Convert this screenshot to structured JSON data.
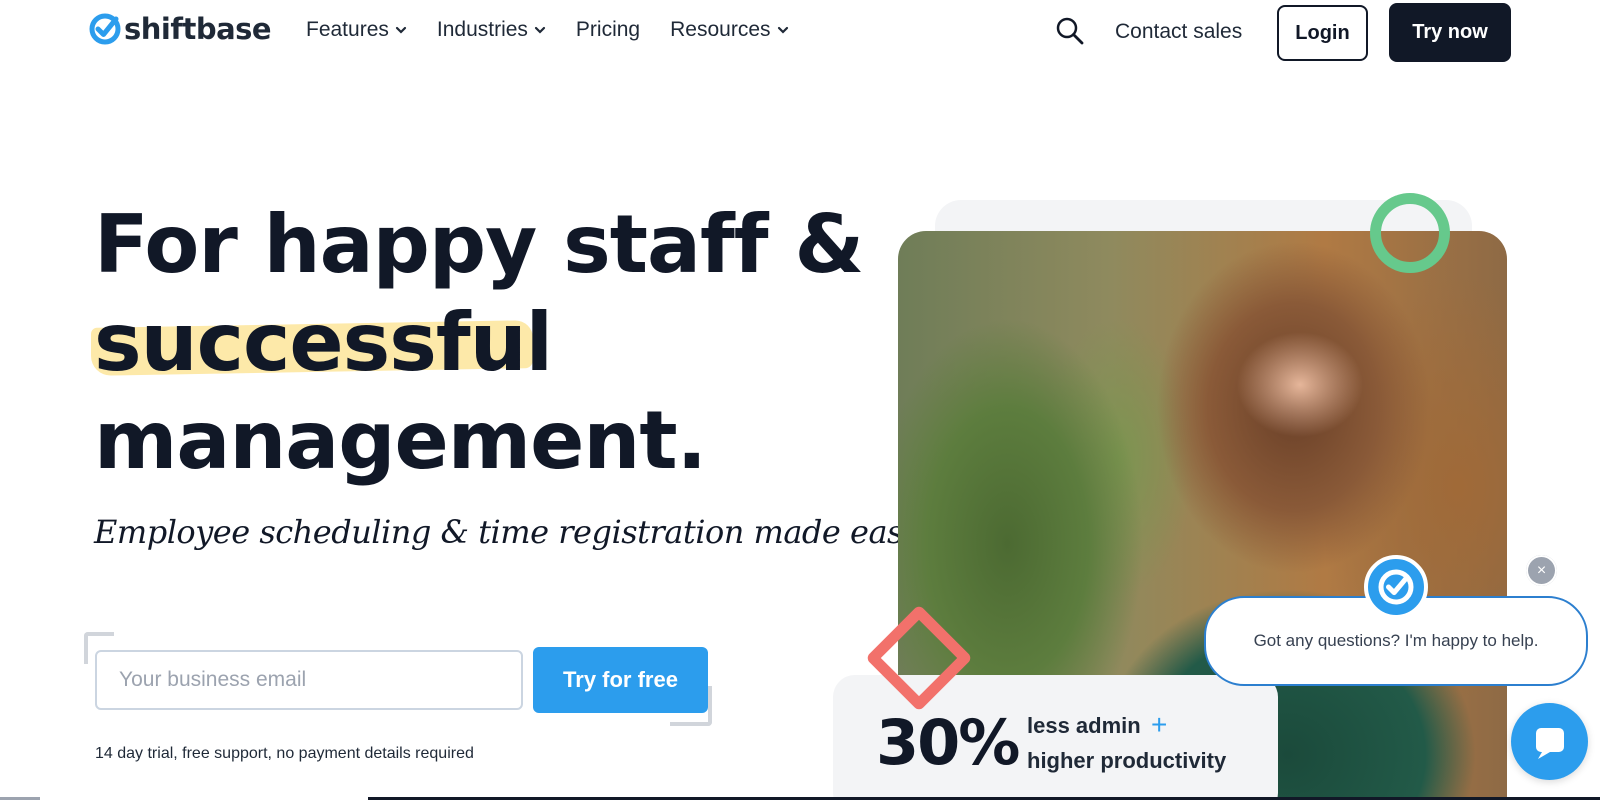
{
  "brand": {
    "name": "shiftbase",
    "accent": "#2c9ded",
    "dark": "#111827"
  },
  "nav": {
    "items": [
      {
        "label": "Features",
        "has_dropdown": true
      },
      {
        "label": "Industries",
        "has_dropdown": true
      },
      {
        "label": "Pricing",
        "has_dropdown": false
      },
      {
        "label": "Resources",
        "has_dropdown": true
      }
    ],
    "search_icon": "search-icon",
    "contact_label": "Contact sales",
    "login_label": "Login",
    "try_label": "Try now"
  },
  "hero": {
    "line1": "For happy staff &",
    "line2": "successful",
    "line3": "management.",
    "subheading": "Employee scheduling & time registration made easy",
    "email_placeholder": "Your business email",
    "email_value": "",
    "cta_label": "Try for free",
    "trial_note": "14 day trial, free support, no payment details required",
    "highlight_color": "#fde9a9"
  },
  "stat": {
    "number": "30%",
    "line1": "less admin",
    "plus": "+",
    "line2": "higher productivity"
  },
  "chat": {
    "close_symbol": "×",
    "message": "Got any questions? I'm happy to help.",
    "launcher_icon": "chat-icon"
  },
  "decor": {
    "ring_color": "#66c98c",
    "diamond_color": "#f2716b"
  }
}
